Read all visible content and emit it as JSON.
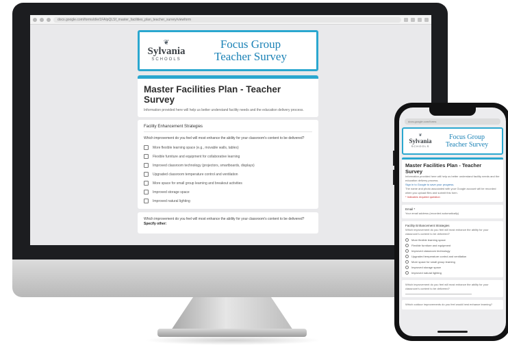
{
  "browser": {
    "url": "docs.google.com/forms/d/e/1FAIpQLSf_master_facilities_plan_teacher_survey/viewform"
  },
  "header": {
    "logo_text": "Sylvania",
    "logo_subtext": "SCHOOLS",
    "banner_line1": "Focus Group",
    "banner_line2": "Teacher Survey"
  },
  "form": {
    "title": "Master Facilities Plan - Teacher Survey",
    "description": "Information provided here will help us better understand facility needs and the education delivery process.",
    "section_title": "Facility Enhancement Strategies",
    "question1": "Which improvement do you feel will most enhance the ability for your classroom's content to be delivered?",
    "options": [
      "More flexible learning space (e.g., movable walls, tables)",
      "Flexible furniture and equipment for collaborative learning",
      "Improved classroom technology (projectors, smartboards, displays)",
      "Upgraded classroom temperature control and ventilation",
      "More space for small group learning and breakout activities",
      "Improved storage space",
      "Improved natural lighting"
    ],
    "question2": "Which improvement do you feel will most enhance the ability for your classroom's content to be delivered?",
    "question2_strong": "Specify other:"
  },
  "phone": {
    "url": "docs.google.com/forms",
    "title": "Master Facilities Plan - Teacher Survey",
    "desc": "Information provided here will help us better understand facility needs and the education delivery process.",
    "email_link": "Sign in to Google to save your progress.",
    "note": "The name and photo associated with your Google account will be recorded when you upload files and submit this form.",
    "required": "* Indicates required question",
    "q_label": "Email *",
    "q_answer": "Your email address (recorded automatically)",
    "section": "Facility Enhancement Strategies",
    "section_q": "Which improvement do you feel will most enhance the ability for your classroom's content to be delivered?",
    "options": [
      "More flexible learning space",
      "Flexible furniture and equipment",
      "Improved classroom technology",
      "Upgraded temperature control and ventilation",
      "More space for small group learning",
      "Improved storage space",
      "Improved natural lighting"
    ],
    "q2": "Which improvement do you feel will most enhance the ability for your classroom's content to be delivered?",
    "q3": "Which outdoor improvements do you feel would best enhance learning?"
  }
}
